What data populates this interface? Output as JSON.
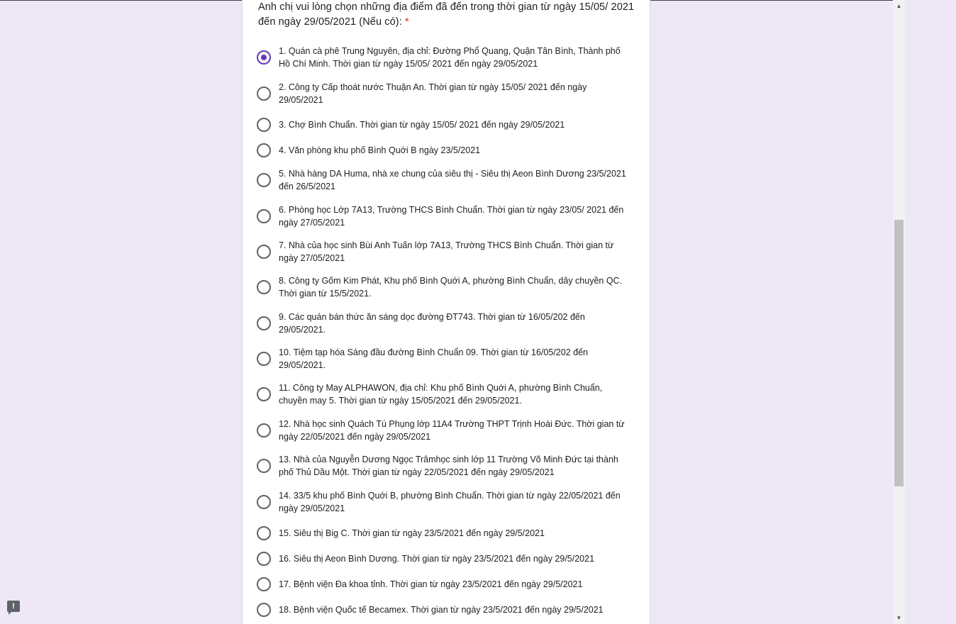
{
  "question": {
    "text": "Anh chị vui lòng chọn những địa điểm đã đến trong thời gian từ ngày 15/05/ 2021 đến ngày 29/05/2021 (Nếu có):",
    "required_marker": "*"
  },
  "options": [
    {
      "label": "1. Quán cà phê Trung Nguyên, địa chỉ: Đường Phổ Quang, Quận Tân Bình, Thành phố Hồ Chí Minh. Thời gian từ ngày 15/05/ 2021 đến ngày 29/05/2021",
      "selected": true
    },
    {
      "label": "2. Công ty Cấp thoát nước Thuận An. Thời gian từ ngày 15/05/ 2021 đến ngày 29/05/2021",
      "selected": false
    },
    {
      "label": "3. Chợ Bình Chuẩn. Thời gian từ ngày 15/05/ 2021 đến ngày 29/05/2021",
      "selected": false
    },
    {
      "label": "4. Văn phòng khu phố Bình Quới B ngày 23/5/2021",
      "selected": false
    },
    {
      "label": "5. Nhà hàng DA Huma, nhà xe chung của siêu thị - Siêu thị Aeon Bình Dương 23/5/2021 đến 26/5/2021",
      "selected": false
    },
    {
      "label": "6. Phòng học Lớp 7A13, Trường THCS Bình Chuẩn. Thời gian từ ngày 23/05/ 2021 đến ngày 27/05/2021",
      "selected": false
    },
    {
      "label": "7. Nhà của học sinh Bùi Anh Tuấn lớp 7A13, Trường THCS Bình Chuẩn. Thời gian từ ngày 27/05/2021",
      "selected": false
    },
    {
      "label": "8. Công ty Gốm Kim Phát, Khu phố Bình Quới A, phường Bình Chuẩn, dây chuyền QC. Thời gian từ 15/5/2021.",
      "selected": false
    },
    {
      "label": "9. Các quán bán thức ăn sáng dọc đường ĐT743. Thời gian từ 16/05/202 đến 29/05/2021.",
      "selected": false
    },
    {
      "label": "10. Tiệm tạp hóa Sáng đầu đường Bình Chuẩn 09. Thời gian từ 16/05/202 đến 29/05/2021.",
      "selected": false
    },
    {
      "label": "11. Công ty May ALPHAWON, địa chỉ: Khu phố Bình Quới A, phường Bình Chuẩn, chuyền may 5. Thời gian từ ngày 15/05/2021 đến 29/05/2021.",
      "selected": false
    },
    {
      "label": "12. Nhà học sinh Quách Tú Phụng lớp 11A4 Trường THPT Trịnh Hoài Đức. Thời gian từ ngày 22/05/2021 đến ngày 29/05/2021",
      "selected": false
    },
    {
      "label": "13. Nhà của Nguyễn Dương Ngọc Trâmhọc sinh lớp 11 Trường Võ Minh Đức tại thành phố Thủ Dầu Một. Thời gian từ ngày 22/05/2021 đến ngày 29/05/2021",
      "selected": false
    },
    {
      "label": "14. 33/5 khu phố Bình Quới B, phường Bình Chuẩn. Thời gian từ ngày 22/05/2021 đến ngày 29/05/2021",
      "selected": false
    },
    {
      "label": "15. Siêu thị Big C. Thời gian từ ngày 23/5/2021 đến ngày 29/5/2021",
      "selected": false
    },
    {
      "label": "16. Siêu thị Aeon Bình Dương. Thời gian từ ngày 23/5/2021 đến ngày 29/5/2021",
      "selected": false
    },
    {
      "label": "17. Bệnh viện Đa khoa tỉnh. Thời gian từ ngày 23/5/2021 đến ngày 29/5/2021",
      "selected": false
    },
    {
      "label": "18. Bệnh viện Quốc tế Becamex. Thời gian từ ngày 23/5/2021 đến ngày 29/5/2021",
      "selected": false
    }
  ],
  "icons": {
    "report": "report-problem-icon",
    "scroll_up": "arrow-up-icon",
    "scroll_down": "arrow-down-icon"
  },
  "colors": {
    "accent": "#673ab7",
    "background": "#ede7f6",
    "required": "#d93025"
  }
}
